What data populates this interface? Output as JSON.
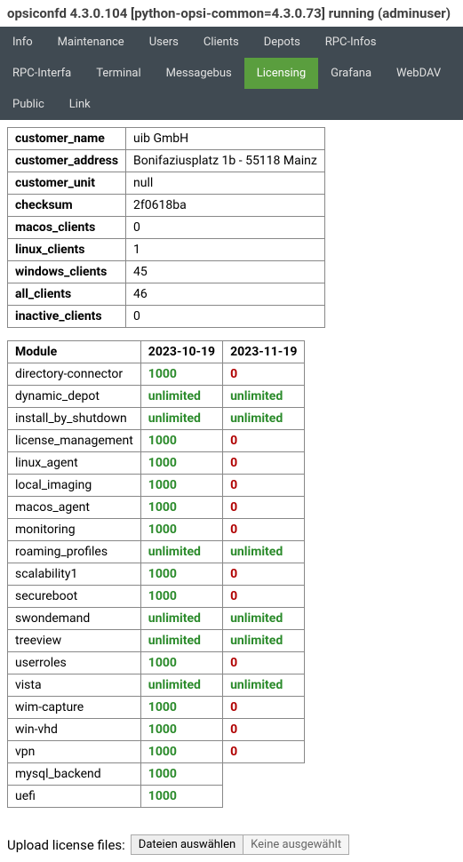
{
  "header": {
    "title": "opsiconfd 4.3.0.104 [python-opsi-common=4.3.0.73] running (adminuser)"
  },
  "tabs": {
    "row1": [
      "Info",
      "Maintenance",
      "Users",
      "Clients",
      "Depots",
      "RPC-Infos",
      "RPC-Interfa"
    ],
    "row2": [
      "Terminal",
      "Messagebus",
      "Licensing",
      "Grafana",
      "WebDAV",
      "Public",
      "Link"
    ],
    "active": "Licensing"
  },
  "info_table": [
    {
      "key": "customer_name",
      "value": "uib GmbH"
    },
    {
      "key": "customer_address",
      "value": "Bonifaziusplatz 1b - 55118 Mainz"
    },
    {
      "key": "customer_unit",
      "value": "null"
    },
    {
      "key": "checksum",
      "value": "2f0618ba"
    },
    {
      "key": "macos_clients",
      "value": "0"
    },
    {
      "key": "linux_clients",
      "value": "1"
    },
    {
      "key": "windows_clients",
      "value": "45"
    },
    {
      "key": "all_clients",
      "value": "46"
    },
    {
      "key": "inactive_clients",
      "value": "0"
    }
  ],
  "module_table": {
    "headers": [
      "Module",
      "2023-10-19",
      "2023-11-19"
    ],
    "rows": [
      {
        "name": "directory-connector",
        "col1": {
          "text": "1000",
          "class": "green"
        },
        "col2": {
          "text": "0",
          "class": "red"
        }
      },
      {
        "name": "dynamic_depot",
        "col1": {
          "text": "unlimited",
          "class": "green"
        },
        "col2": {
          "text": "unlimited",
          "class": "green"
        }
      },
      {
        "name": "install_by_shutdown",
        "col1": {
          "text": "unlimited",
          "class": "green"
        },
        "col2": {
          "text": "unlimited",
          "class": "green"
        }
      },
      {
        "name": "license_management",
        "col1": {
          "text": "1000",
          "class": "green"
        },
        "col2": {
          "text": "0",
          "class": "red"
        }
      },
      {
        "name": "linux_agent",
        "col1": {
          "text": "1000",
          "class": "green"
        },
        "col2": {
          "text": "0",
          "class": "red"
        }
      },
      {
        "name": "local_imaging",
        "col1": {
          "text": "1000",
          "class": "green"
        },
        "col2": {
          "text": "0",
          "class": "red"
        }
      },
      {
        "name": "macos_agent",
        "col1": {
          "text": "1000",
          "class": "green"
        },
        "col2": {
          "text": "0",
          "class": "red"
        }
      },
      {
        "name": "monitoring",
        "col1": {
          "text": "1000",
          "class": "green"
        },
        "col2": {
          "text": "0",
          "class": "red"
        }
      },
      {
        "name": "roaming_profiles",
        "col1": {
          "text": "unlimited",
          "class": "green"
        },
        "col2": {
          "text": "unlimited",
          "class": "green"
        }
      },
      {
        "name": "scalability1",
        "col1": {
          "text": "1000",
          "class": "green"
        },
        "col2": {
          "text": "0",
          "class": "red"
        }
      },
      {
        "name": "secureboot",
        "col1": {
          "text": "1000",
          "class": "green"
        },
        "col2": {
          "text": "0",
          "class": "red"
        }
      },
      {
        "name": "swondemand",
        "col1": {
          "text": "unlimited",
          "class": "green"
        },
        "col2": {
          "text": "unlimited",
          "class": "green"
        }
      },
      {
        "name": "treeview",
        "col1": {
          "text": "unlimited",
          "class": "green"
        },
        "col2": {
          "text": "unlimited",
          "class": "green"
        }
      },
      {
        "name": "userroles",
        "col1": {
          "text": "1000",
          "class": "green"
        },
        "col2": {
          "text": "0",
          "class": "red"
        }
      },
      {
        "name": "vista",
        "col1": {
          "text": "unlimited",
          "class": "green"
        },
        "col2": {
          "text": "unlimited",
          "class": "green"
        }
      },
      {
        "name": "wim-capture",
        "col1": {
          "text": "1000",
          "class": "green"
        },
        "col2": {
          "text": "0",
          "class": "red"
        }
      },
      {
        "name": "win-vhd",
        "col1": {
          "text": "1000",
          "class": "green"
        },
        "col2": {
          "text": "0",
          "class": "red"
        }
      },
      {
        "name": "vpn",
        "col1": {
          "text": "1000",
          "class": "green"
        },
        "col2": {
          "text": "0",
          "class": "red"
        }
      },
      {
        "name": "mysql_backend",
        "col1": {
          "text": "1000",
          "class": "green"
        },
        "col2": null
      },
      {
        "name": "uefi",
        "col1": {
          "text": "1000",
          "class": "green"
        },
        "col2": null
      }
    ]
  },
  "upload": {
    "label": "Upload license files:",
    "button": "Dateien auswählen",
    "status": "Keine ausgewählt"
  }
}
